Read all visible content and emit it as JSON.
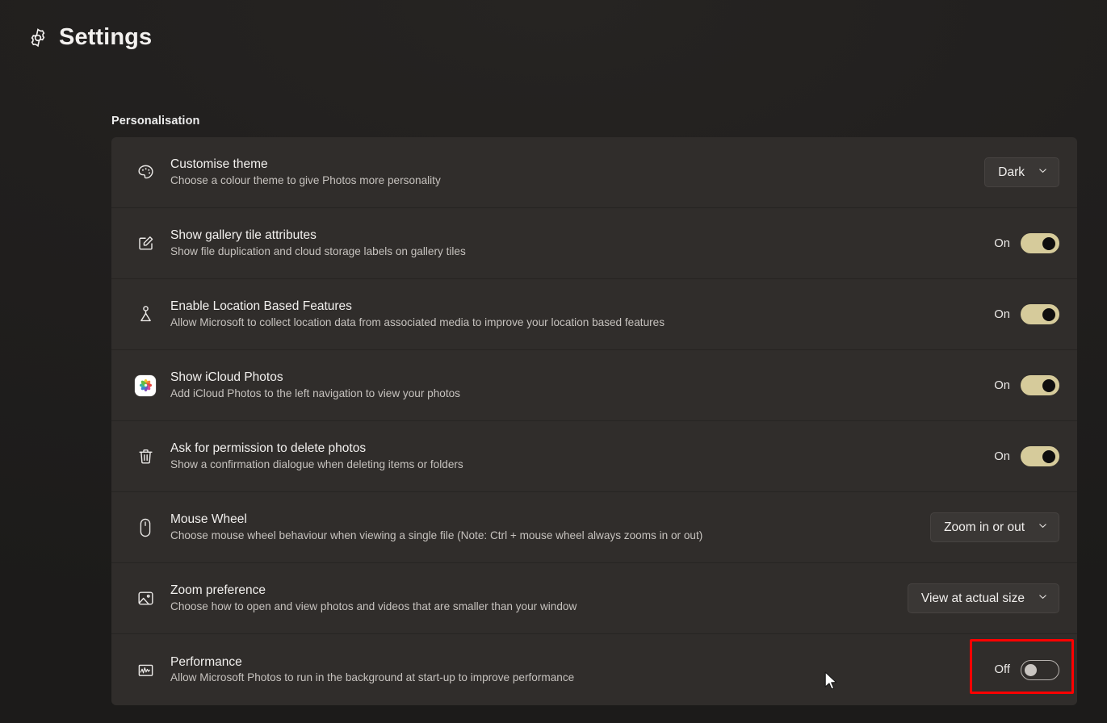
{
  "app": {
    "title": "Settings",
    "gear_icon": "gear-icon",
    "background_color": "#1d1c1b",
    "row_color": "#302d2b",
    "accent_toggle_on_color": "#d6cb9b",
    "highlight_color": "#fe0000"
  },
  "section": {
    "heading": "Personalisation"
  },
  "rows": [
    {
      "icon": "palette-icon",
      "title": "Customise theme",
      "subtitle": "Choose a colour theme to give Photos more personality",
      "control": "dropdown",
      "value": "Dark"
    },
    {
      "icon": "edit-gallery-tile-icon",
      "title": "Show gallery tile attributes",
      "subtitle": "Show file duplication and cloud storage labels on gallery tiles",
      "control": "toggle",
      "value": "On",
      "state": "on"
    },
    {
      "icon": "location-pin-icon",
      "title": "Enable Location Based Features",
      "subtitle": "Allow Microsoft to collect location data from associated media to improve your location based features",
      "control": "toggle",
      "value": "On",
      "state": "on"
    },
    {
      "icon": "icloud-photos-icon",
      "title": "Show iCloud Photos",
      "subtitle": "Add iCloud Photos to the left navigation to view your photos",
      "control": "toggle",
      "value": "On",
      "state": "on"
    },
    {
      "icon": "trash-icon",
      "title": "Ask for permission to delete photos",
      "subtitle": "Show a confirmation dialogue when deleting items or folders",
      "control": "toggle",
      "value": "On",
      "state": "on"
    },
    {
      "icon": "mouse-icon",
      "title": "Mouse Wheel",
      "subtitle": "Choose mouse wheel behaviour when viewing a single file (Note: Ctrl + mouse wheel always zooms in or out)",
      "control": "dropdown",
      "value": "Zoom in or out"
    },
    {
      "icon": "image-icon",
      "title": "Zoom preference",
      "subtitle": "Choose how to open and view photos and videos that are smaller than your window",
      "control": "dropdown",
      "value": "View at actual size"
    },
    {
      "icon": "performance-chart-icon",
      "title": "Performance",
      "subtitle": "Allow Microsoft Photos to run in the background at start-up to improve performance",
      "control": "toggle",
      "value": "Off",
      "state": "off",
      "highlighted": true
    }
  ]
}
